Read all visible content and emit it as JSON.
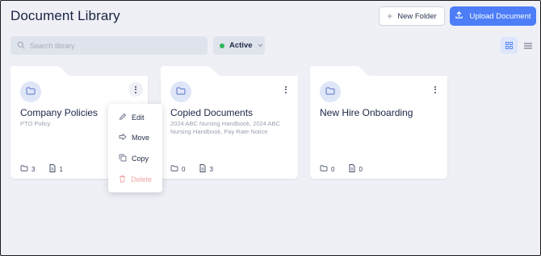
{
  "header": {
    "title": "Document Library",
    "new_folder_label": "New Folder",
    "upload_label": "Upload Document"
  },
  "toolbar": {
    "search_placeholder": "Search library",
    "status_label": "Active",
    "status_color": "#2fb55a"
  },
  "colors": {
    "accent": "#4d7ef7",
    "danger": "#f0a5a2"
  },
  "cards": [
    {
      "name": "Company Policies",
      "subtitle": "PTO Policy",
      "folders": "3",
      "files": "1"
    },
    {
      "name": "Copied Documents",
      "subtitle": "2024 ABC Nursing Handbook, 2024 ABC Nursing Handbook, Pay Rate Notice",
      "folders": "0",
      "files": "3"
    },
    {
      "name": "New Hire Onboarding",
      "subtitle": "",
      "folders": "0",
      "files": "0"
    }
  ],
  "context_menu": {
    "items": [
      {
        "label": "Edit",
        "icon": "pencil-icon"
      },
      {
        "label": "Move",
        "icon": "move-arrow-icon"
      },
      {
        "label": "Copy",
        "icon": "copy-icon"
      },
      {
        "label": "Delete",
        "icon": "trash-icon"
      }
    ]
  }
}
